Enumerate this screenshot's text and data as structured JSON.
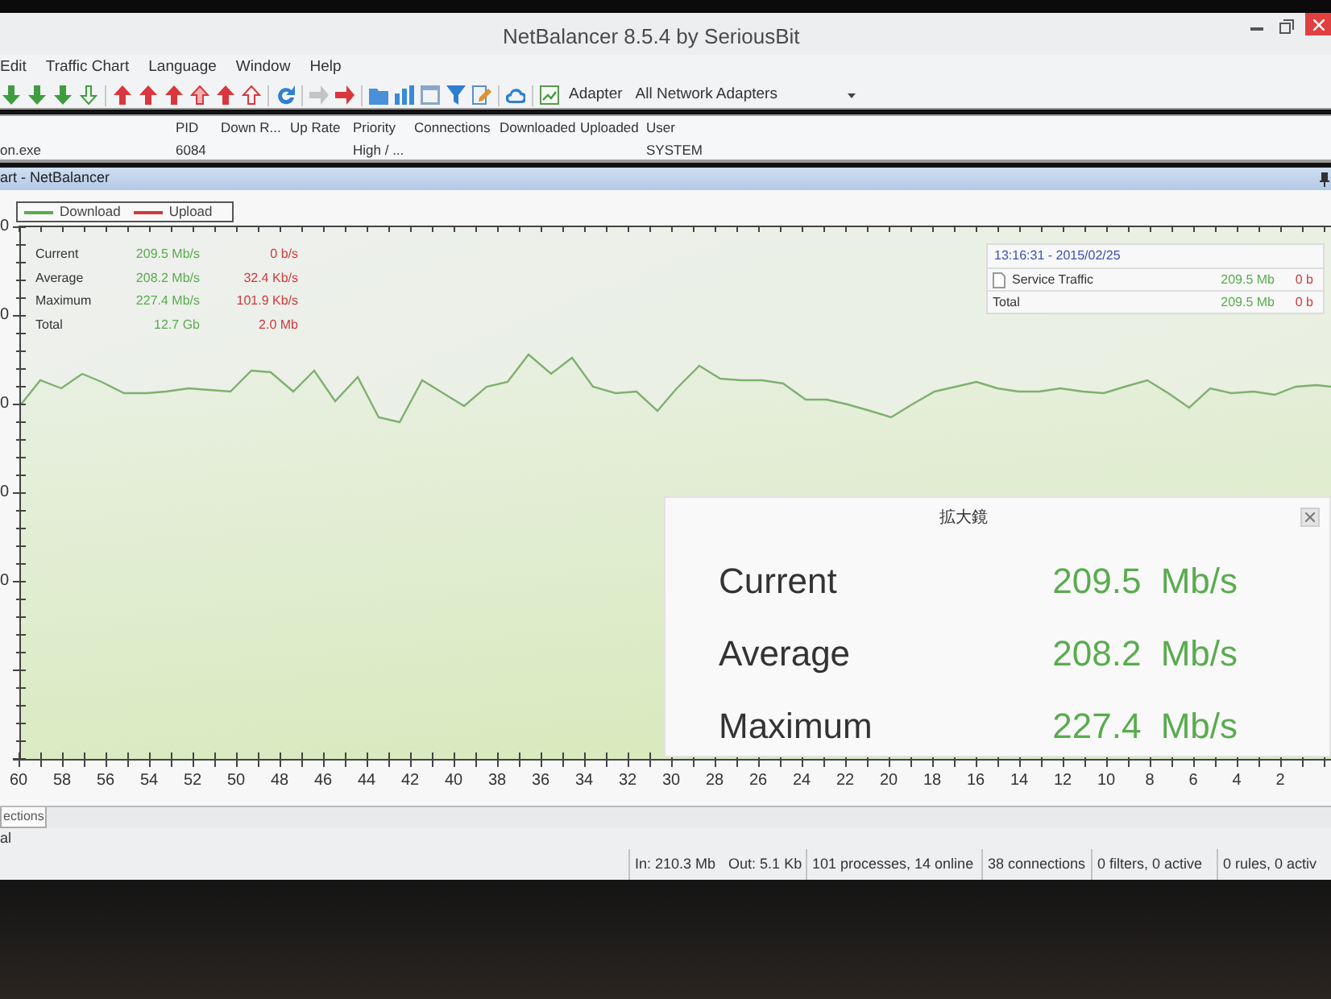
{
  "window": {
    "title": "NetBalancer 8.5.4 by SeriousBit"
  },
  "menu": [
    {
      "label": "Edit"
    },
    {
      "label": "Traffic Chart"
    },
    {
      "label": "Language"
    },
    {
      "label": "Window"
    },
    {
      "label": "Help"
    }
  ],
  "toolbar": {
    "adapter_label": "Adapter",
    "adapter_value": "All Network Adapters"
  },
  "process_table": {
    "columns": [
      "PID",
      "Down R...",
      "Up Rate",
      "Priority",
      "Connections",
      "Downloaded",
      "Uploaded",
      "User"
    ],
    "rows": [
      {
        "column_1": "on.exe",
        "pid": "6084",
        "priority": "High / ...",
        "user": "SYSTEM"
      }
    ]
  },
  "chart_panel": {
    "title": "art - NetBalancer",
    "legend": [
      {
        "label": "Download",
        "color": "#5aab4f"
      },
      {
        "label": "Upload",
        "color": "#d0393b"
      }
    ],
    "stats": [
      {
        "label": "Current",
        "download": "209.5 Mb/s",
        "upload": "0 b/s"
      },
      {
        "label": "Average",
        "download": "208.2 Mb/s",
        "upload": "32.4 Kb/s"
      },
      {
        "label": "Maximum",
        "download": "227.4 Mb/s",
        "upload": "101.9 Kb/s"
      },
      {
        "label": "Total",
        "download": "12.7 Gb",
        "upload": "2.0 Mb"
      }
    ],
    "info_box": {
      "timestamp": "13:16:31 - 2015/02/25",
      "rows": [
        {
          "kind": "item",
          "label": "Service Traffic",
          "download": "209.5 Mb",
          "upload": "0 b"
        },
        {
          "kind": "total",
          "label": "Total",
          "download": "209.5 Mb",
          "upload": "0 b"
        }
      ]
    },
    "y_axis_labels": [
      "0",
      "0",
      "0",
      "0",
      "0"
    ],
    "x_axis_labels": [
      "60",
      "58",
      "56",
      "54",
      "52",
      "50",
      "48",
      "46",
      "44",
      "42",
      "40",
      "38",
      "36",
      "34",
      "32",
      "30",
      "28",
      "26",
      "24",
      "22",
      "20",
      "18",
      "16",
      "14",
      "12",
      "10",
      "8",
      "6",
      "4",
      "2"
    ]
  },
  "magnifier": {
    "title": "拡大鏡",
    "rows": [
      {
        "label": "Current",
        "value": "209.5 Mb/s"
      },
      {
        "label": "Average",
        "value": "208.2 Mb/s"
      },
      {
        "label": "Maximum",
        "value": "227.4 Mb/s"
      }
    ]
  },
  "bottom_panel": {
    "tabs": [
      {
        "label": "ections",
        "selected": true
      }
    ],
    "text": "al"
  },
  "status_bar": {
    "cells": [
      {
        "texts": [
          "In: 210.3 Mb",
          "Out: 5.1 Kb"
        ]
      },
      {
        "texts": [
          "101 processes, 14 online"
        ]
      },
      {
        "texts": [
          "38 connections"
        ]
      },
      {
        "texts": [
          "0 filters, 0 active"
        ]
      },
      {
        "texts": [
          "0 rules, 0 activ"
        ]
      }
    ]
  }
}
